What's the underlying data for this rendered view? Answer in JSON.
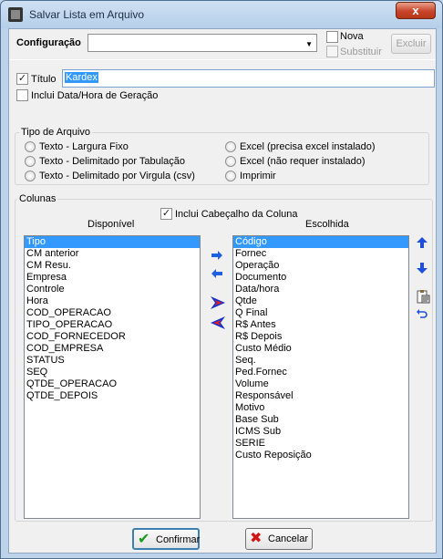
{
  "window": {
    "title": "Salvar Lista em Arquivo",
    "close_label": "x"
  },
  "config": {
    "label": "Configuração",
    "combo_value": "",
    "nova_label": "Nova",
    "substituir_label": "Substituir",
    "excluir_label": "Excluir"
  },
  "titulo": {
    "checkbox_label": "Título",
    "value": "Kardex",
    "inclui_data_label": "Inclui Data/Hora de Geração"
  },
  "tipo_arquivo": {
    "group_title": "Tipo de Arquivo",
    "options": [
      "Texto - Largura Fixo",
      "Texto - Delimitado por Tabulação",
      "Texto - Delimitado por Virgula (csv)",
      "Excel (precisa excel instalado)",
      "Excel (não requer instalado)",
      "Imprimir"
    ]
  },
  "colunas": {
    "group_title": "Colunas",
    "inclui_cabecalho_label": "Inclui Cabeçalho da Coluna",
    "disponivel_label": "Disponível",
    "escolhida_label": "Escolhida",
    "disponivel": [
      "Tipo",
      "CM anterior",
      "CM Resu.",
      "Empresa",
      "Controle",
      "Hora",
      "COD_OPERACAO",
      "TIPO_OPERACAO",
      "COD_FORNECEDOR",
      "COD_EMPRESA",
      "STATUS",
      "SEQ",
      "QTDE_OPERACAO",
      "QTDE_DEPOIS"
    ],
    "escolhida": [
      "Código",
      "Fornec",
      "Operação",
      "Documento",
      "Data/hora",
      "Qtde",
      "Q Final",
      "R$ Antes",
      "R$ Depois",
      "Custo Médio",
      "Seq.",
      "Ped.Fornec",
      "Volume",
      "Responsável",
      "Motivo",
      "Base Sub",
      "ICMS Sub",
      "SERIE",
      "Custo Reposição"
    ]
  },
  "footer": {
    "confirmar_label": "Confirmar",
    "cancelar_label": "Cancelar"
  }
}
